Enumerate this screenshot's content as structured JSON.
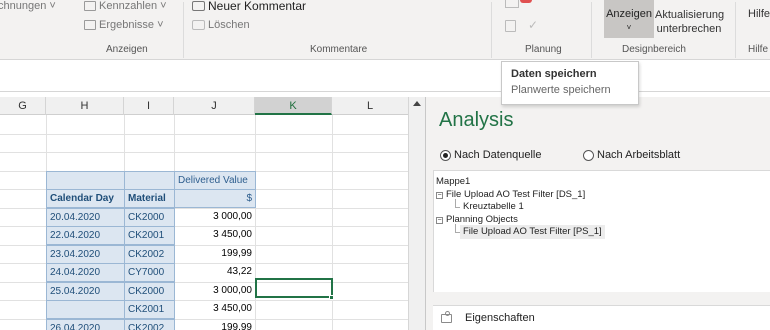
{
  "ribbon": {
    "items": {
      "berechnungen": "chnungen ˅",
      "kennzahlen": "Kennzahlen ˅",
      "ergebnisse": "Ergebnisse ˅",
      "neuer_kommentar": "Neuer Kommentar",
      "loeschen": "Löschen",
      "anzeigen": "Anzeigen",
      "anzeigen_chevron": "˅",
      "aktualisierung_line1": "Aktualisierung",
      "aktualisierung_line2": "unterbrechen",
      "hilfe": "Hilfe"
    },
    "groups": {
      "anzeigen": "Anzeigen",
      "kommentare": "Kommentare",
      "planung": "Planung",
      "designbereich": "Designbereich",
      "hilfe": "Hilfe"
    }
  },
  "tooltip": {
    "title": "Daten speichern",
    "description": "Planwerte speichern"
  },
  "sheet": {
    "columns": [
      "G",
      "H",
      "I",
      "J",
      "K",
      "L"
    ],
    "selected_column": "K",
    "table": {
      "header_top": "Delivered Value",
      "header_calendar_day": "Calendar Day",
      "header_material": "Material",
      "header_unit": "$",
      "rows": [
        {
          "date": "20.04.2020",
          "material": "CK2000",
          "value": "3 000,00"
        },
        {
          "date": "22.04.2020",
          "material": "CK2001",
          "value": "3 450,00"
        },
        {
          "date": "23.04.2020",
          "material": "CK2002",
          "value": "199,99"
        },
        {
          "date": "24.04.2020",
          "material": "CY7000",
          "value": "43,22"
        },
        {
          "date": "25.04.2020",
          "material": "CK2000",
          "value": "3 000,00"
        },
        {
          "date": "",
          "material": "CK2001",
          "value": "3 450,00"
        },
        {
          "date": "26.04.2020",
          "material": "CK2002",
          "value": "199,99"
        }
      ]
    }
  },
  "analysis": {
    "title": "Analysis",
    "radio_datenquelle": "Nach Datenquelle",
    "radio_arbeitsblatt": "Nach Arbeitsblatt",
    "selected_radio": "Nach Datenquelle",
    "tree": {
      "root": "Mappe1",
      "node1": "File Upload AO Test Filter [DS_1]",
      "node1_child": "Kreuztabelle 1",
      "node2": "Planning Objects",
      "node2_child": "File Upload AO Test Filter [PS_1]",
      "expand_symbol": "⊟"
    },
    "properties_label": "Eigenschaften"
  },
  "colors": {
    "excel_green": "#217346",
    "table_header_bg": "#dce6f1",
    "table_text": "#1f4e79",
    "pane_bg": "#f3f2f1"
  }
}
